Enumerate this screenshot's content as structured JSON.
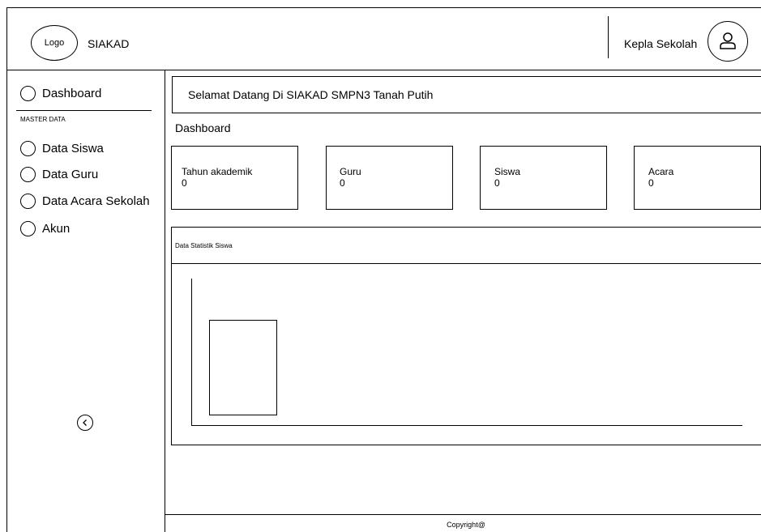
{
  "header": {
    "logo_text": "Logo",
    "app_name": "SIAKAD",
    "user_role": "Kepla Sekolah",
    "avatar_icon": "user-icon"
  },
  "sidebar": {
    "items_top": [
      {
        "label": "Dashboard"
      }
    ],
    "section_label": "MASTER DATA",
    "items_master": [
      {
        "label": "Data Siswa"
      },
      {
        "label": "Data Guru"
      },
      {
        "label": "Data Acara Sekolah"
      },
      {
        "label": "Akun"
      }
    ],
    "collapse_icon": "chevron-left-icon"
  },
  "main": {
    "welcome": "Selamat Datang Di SIAKAD SMPN3 Tanah Putih",
    "page_title": "Dashboard",
    "cards": [
      {
        "label": "Tahun akademik",
        "value": "0"
      },
      {
        "label": "Guru",
        "value": "0"
      },
      {
        "label": "Siswa",
        "value": "0"
      },
      {
        "label": "Acara",
        "value": "0"
      }
    ],
    "chart_title": "Data Statistik Siswa"
  },
  "chart_data": {
    "type": "bar",
    "categories": [
      ""
    ],
    "values": [
      65
    ],
    "ylim": [
      0,
      100
    ],
    "title": "Data Statistik Siswa",
    "grid": false
  },
  "footer": {
    "text": "Copyright@"
  }
}
